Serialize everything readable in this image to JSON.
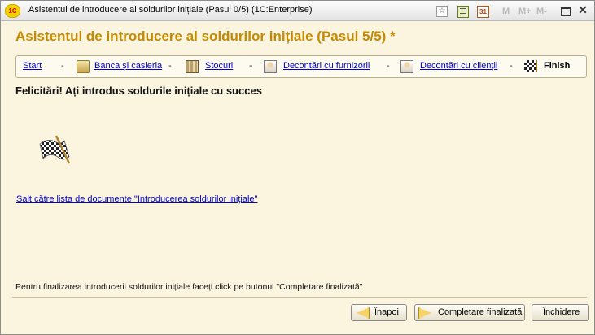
{
  "window": {
    "title": "Asistentul de introducere al soldurilor inițiale (Pasul 0/5)  (1C:Enterprise)",
    "app_icon": "1C",
    "toolbar": {
      "m_label": "M",
      "mplus_label": "M+",
      "mminus_label": "M-",
      "calendar_label": "31",
      "close_glyph": "✕"
    }
  },
  "heading": "Asistentul de introducere al soldurilor inițiale (Pasul 5/5) *",
  "steps": [
    {
      "label": "Start",
      "icon": "none"
    },
    {
      "label": "Banca și casieria",
      "icon": "bank-icon"
    },
    {
      "label": "Stocuri",
      "icon": "warehouse-icon"
    },
    {
      "label": "Decontări cu furnizorii",
      "icon": "supplier-person-icon"
    },
    {
      "label": "Decontări cu clienții",
      "icon": "customer-person-icon"
    },
    {
      "label": "Finish",
      "icon": "checkered-flag-icon"
    }
  ],
  "separator": "-",
  "congrats_message": "Felicitări! Ați introdus soldurile inițiale cu succes",
  "documents_link": "Salt către lista de documente \"Introducerea soldurilor inițiale\"",
  "hint": "Pentru finalizarea introducerii soldurilor inițiale faceți click pe butonul \"Completare finalizată\"",
  "buttons": {
    "back": "Înapoi",
    "complete": "Completare finalizată",
    "close": "Închidere"
  }
}
